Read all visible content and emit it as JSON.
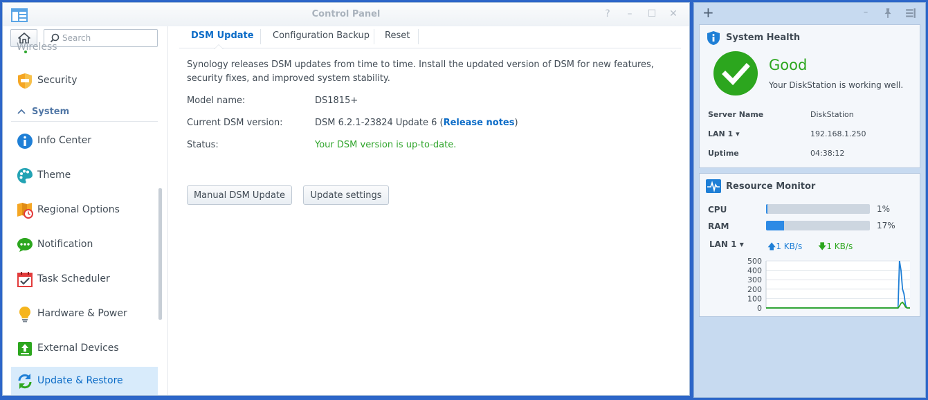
{
  "window": {
    "title": "Control Panel",
    "buttons": {
      "help": "?",
      "minimize": "–",
      "maximize": "☐",
      "close": "✕"
    }
  },
  "sidebar": {
    "search_placeholder": "Search",
    "partial_item": "Wireless",
    "items_top": [
      {
        "label": "Security",
        "icon": "shield-icon"
      }
    ],
    "section": {
      "label": "System",
      "icon": "chevron-up-icon"
    },
    "items": [
      {
        "label": "Info Center",
        "icon": "info-icon"
      },
      {
        "label": "Theme",
        "icon": "palette-icon"
      },
      {
        "label": "Regional Options",
        "icon": "map-clock-icon"
      },
      {
        "label": "Notification",
        "icon": "chat-bubble-icon"
      },
      {
        "label": "Task Scheduler",
        "icon": "calendar-check-icon"
      },
      {
        "label": "Hardware & Power",
        "icon": "lightbulb-icon"
      },
      {
        "label": "External Devices",
        "icon": "upload-icon"
      },
      {
        "label": "Update & Restore",
        "icon": "refresh-icon",
        "active": true
      }
    ]
  },
  "tabs": [
    {
      "label": "DSM Update",
      "active": true
    },
    {
      "label": "Configuration Backup"
    },
    {
      "label": "Reset"
    }
  ],
  "content": {
    "intro": "Synology releases DSM updates from time to time. Install the updated version of DSM for new features, security fixes, and improved system stability.",
    "model_label": "Model name:",
    "model_value": "DS1815+",
    "version_label": "Current DSM version:",
    "version_value": "DSM 6.2.1-23824 Update 6 (",
    "release_notes": "Release notes",
    "version_suffix": ")",
    "status_label": "Status:",
    "status_value": "Your DSM version is up-to-date.",
    "manual_update_button": "Manual DSM Update",
    "update_settings_button": "Update settings"
  },
  "widget_panel": {
    "add": "+",
    "controls": {
      "minimize": "–",
      "pin": "📌",
      "layout": "☰"
    }
  },
  "system_health": {
    "title": "System Health",
    "status": "Good",
    "message": "Your DiskStation is working well.",
    "server_name_label": "Server Name",
    "server_name_value": "DiskStation",
    "lan_label": "LAN 1",
    "lan_value": "192.168.1.250",
    "uptime_label": "Uptime",
    "uptime_value": "04:38:12"
  },
  "resource_monitor": {
    "title": "Resource Monitor",
    "cpu_label": "CPU",
    "cpu_percent": 1,
    "cpu_text": "1%",
    "ram_label": "RAM",
    "ram_percent": 17,
    "ram_text": "17%",
    "lan_label": "LAN 1",
    "upload_rate": "1 KB/s",
    "download_rate": "1 KB/s",
    "colors": {
      "upload": "#1f7fd6",
      "download": "#2ca61e"
    }
  },
  "chart_data": {
    "type": "line",
    "title": "",
    "xlabel": "",
    "ylabel": "",
    "ylim": [
      0,
      500
    ],
    "yticks": [
      "500",
      "400",
      "300",
      "200",
      "100",
      "0"
    ],
    "grid": true,
    "series": [
      {
        "values": [
          0,
          0,
          0,
          0,
          0,
          0,
          0,
          0,
          0,
          0,
          0,
          0,
          0,
          0,
          0,
          0,
          0,
          0,
          0,
          0,
          0,
          0,
          0,
          0,
          0,
          0,
          0,
          0,
          0,
          0,
          0,
          0,
          0,
          0,
          0,
          0,
          0,
          0,
          0,
          0,
          0,
          0,
          0,
          0,
          0,
          0,
          0,
          0,
          0,
          0,
          0,
          0,
          0,
          0,
          0,
          0,
          0,
          0,
          0,
          0,
          0,
          0,
          0,
          0,
          0,
          0,
          0,
          0,
          0,
          0,
          0,
          0,
          0,
          0,
          0,
          0,
          0,
          0,
          0,
          0,
          0,
          0,
          0,
          0,
          0,
          0,
          0,
          0,
          0,
          500,
          400,
          200,
          150,
          30,
          0,
          0,
          0
        ],
        "color": "#1f7fd6"
      },
      {
        "values": [
          0,
          0,
          0,
          0,
          0,
          0,
          0,
          0,
          0,
          0,
          0,
          0,
          0,
          0,
          0,
          0,
          0,
          0,
          0,
          0,
          0,
          0,
          0,
          0,
          0,
          0,
          0,
          0,
          0,
          0,
          0,
          0,
          0,
          0,
          0,
          0,
          0,
          0,
          0,
          0,
          0,
          0,
          0,
          0,
          0,
          0,
          0,
          0,
          0,
          0,
          0,
          0,
          0,
          0,
          0,
          0,
          0,
          0,
          0,
          0,
          0,
          0,
          0,
          0,
          0,
          0,
          0,
          0,
          0,
          0,
          0,
          0,
          0,
          0,
          0,
          0,
          0,
          0,
          0,
          0,
          0,
          0,
          0,
          0,
          0,
          0,
          0,
          0,
          0,
          20,
          50,
          60,
          40,
          10,
          0,
          0,
          0
        ],
        "color": "#2ca61e"
      }
    ]
  }
}
